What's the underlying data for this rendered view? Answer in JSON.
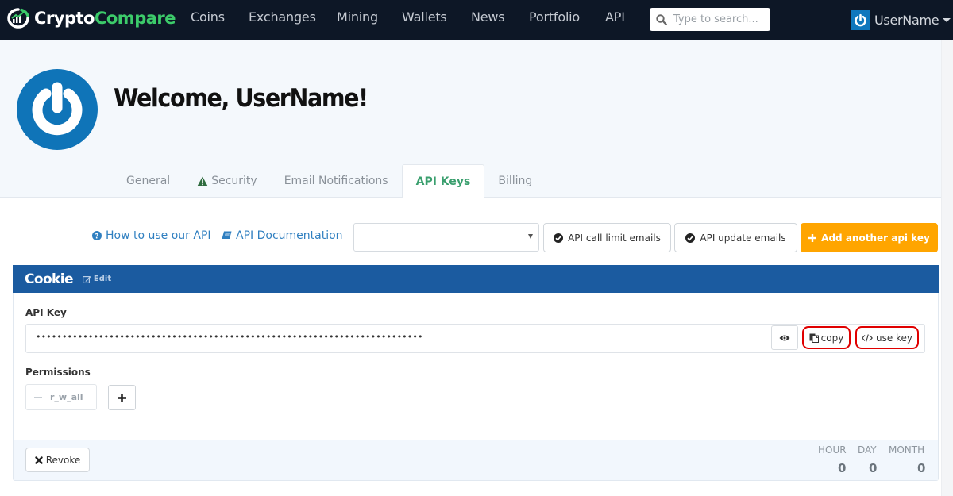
{
  "navbar": {
    "logo": {
      "part1": "Crypto",
      "part2": "Compare",
      "icon": "chart-logo-icon"
    },
    "items": [
      {
        "label": "Coins"
      },
      {
        "label": "Exchanges"
      },
      {
        "label": "Mining"
      },
      {
        "label": "Wallets"
      },
      {
        "label": "News"
      },
      {
        "label": "Portfolio"
      },
      {
        "label": "API"
      }
    ],
    "search": {
      "placeholder": "Type to search...",
      "value": ""
    },
    "user": {
      "name": "UserName",
      "icon": "power-icon"
    }
  },
  "profile": {
    "welcome": "Welcome, UserName!",
    "tabs": [
      {
        "label": "General",
        "active": false
      },
      {
        "label": "Security",
        "active": false,
        "icon": "warning-icon"
      },
      {
        "label": "Email Notifications",
        "active": false
      },
      {
        "label": "API Keys",
        "active": true
      },
      {
        "label": "Billing",
        "active": false
      }
    ]
  },
  "toolbar": {
    "how_to_link": "How to use our API",
    "docs_link": "API Documentation",
    "select_value": "",
    "call_limit_emails": "API call limit emails",
    "update_emails": "API update emails",
    "add_key": "Add another api key"
  },
  "api_key": {
    "name": "Cookie",
    "edit_label": "Edit",
    "key_label": "API Key",
    "key_masked": "••••••••••••••••••••••••••••••••••••••••••••••••••••••••••••••••••••••••••",
    "copy_label": "copy",
    "use_key_label": "use key",
    "permissions_label": "Permissions",
    "permissions": [
      {
        "label": "r_w_all"
      }
    ],
    "revoke_label": "Revoke",
    "usage": [
      {
        "period": "HOUR",
        "value": "0"
      },
      {
        "period": "DAY",
        "value": "0"
      },
      {
        "period": "MONTH",
        "value": "0"
      }
    ]
  },
  "colors": {
    "nav_bg": "#0d1726",
    "brand_green": "#3ccb6a",
    "panel_header": "#1b5ba0",
    "accent_orange": "#ffa500",
    "active_tab": "#3a9f6e",
    "link_blue": "#2f7fc0",
    "highlight_red": "#e00000"
  }
}
